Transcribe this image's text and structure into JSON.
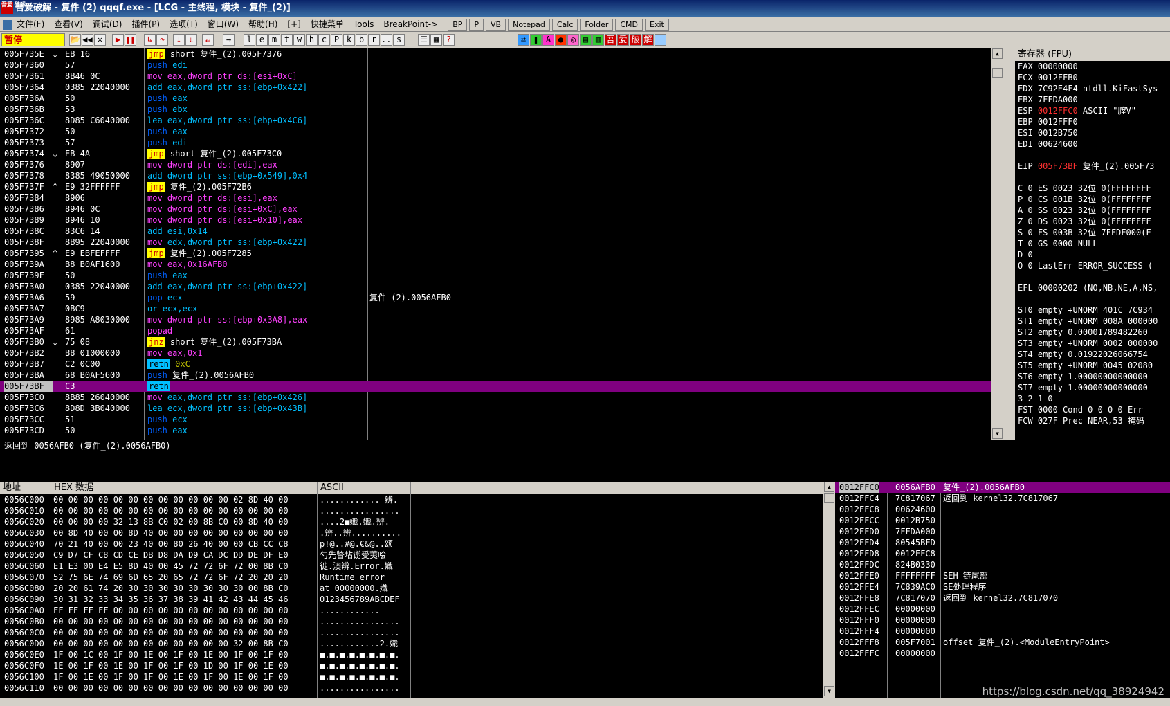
{
  "window": {
    "title": "吾爱破解 - 复件 (2) qqqf.exe - [LCG - 主线程, 模块 - 复件_(2)]",
    "logo": "吾爱 破解"
  },
  "menu": {
    "items": [
      "文件(F)",
      "查看(V)",
      "调试(D)",
      "插件(P)",
      "选项(T)",
      "窗口(W)",
      "帮助(H)",
      "[+]",
      "快捷菜单",
      "Tools",
      "BreakPoint->"
    ],
    "buttons": [
      "BP",
      "P",
      "VB",
      "Notepad",
      "Calc",
      "Folder",
      "CMD",
      "Exit"
    ]
  },
  "toolbar": {
    "status": "暂停",
    "letters": [
      "l",
      "e",
      "m",
      "t",
      "w",
      "h",
      "c",
      "P",
      "k",
      "b",
      "r",
      "...",
      "s"
    ]
  },
  "cpu": {
    "rows": [
      {
        "addr": "005F735E",
        "mark": "⌄",
        "hex": "EB 16",
        "op": "jmp",
        "cls": "jmp",
        "arg": "short 复件_(2).005F7376",
        "argcls": "white",
        "cmt": ""
      },
      {
        "addr": "005F7360",
        "mark": "",
        "hex": "57",
        "op": "push",
        "cls": "push",
        "arg": "edi",
        "argcls": "ops",
        "cmt": ""
      },
      {
        "addr": "005F7361",
        "mark": "",
        "hex": "8B46 0C",
        "op": "mov",
        "cls": "mov",
        "arg": "eax,dword ptr ds:[esi+0xC]",
        "argcls": "opm",
        "cmt": ""
      },
      {
        "addr": "005F7364",
        "mark": "",
        "hex": "0385 22040000",
        "op": "add",
        "cls": "add",
        "arg": "eax,dword ptr ss:[ebp+0x422]",
        "argcls": "ops",
        "cmt": ""
      },
      {
        "addr": "005F736A",
        "mark": "",
        "hex": "50",
        "op": "push",
        "cls": "push",
        "arg": "eax",
        "argcls": "ops",
        "cmt": ""
      },
      {
        "addr": "005F736B",
        "mark": "",
        "hex": "53",
        "op": "push",
        "cls": "push",
        "arg": "ebx",
        "argcls": "ops",
        "cmt": ""
      },
      {
        "addr": "005F736C",
        "mark": "",
        "hex": "8D85 C6040000",
        "op": "lea",
        "cls": "add",
        "arg": "eax,dword ptr ss:[ebp+0x4C6]",
        "argcls": "ops",
        "cmt": ""
      },
      {
        "addr": "005F7372",
        "mark": "",
        "hex": "50",
        "op": "push",
        "cls": "push",
        "arg": "eax",
        "argcls": "ops",
        "cmt": ""
      },
      {
        "addr": "005F7373",
        "mark": "",
        "hex": "57",
        "op": "push",
        "cls": "push",
        "arg": "edi",
        "argcls": "ops",
        "cmt": ""
      },
      {
        "addr": "005F7374",
        "mark": "⌄",
        "hex": "EB 4A",
        "op": "jmp",
        "cls": "jmp",
        "arg": "short 复件_(2).005F73C0",
        "argcls": "white",
        "cmt": ""
      },
      {
        "addr": "005F7376",
        "mark": "",
        "hex": "8907",
        "op": "mov",
        "cls": "mov",
        "arg": "dword ptr ds:[edi],eax",
        "argcls": "opm",
        "cmt": ""
      },
      {
        "addr": "005F7378",
        "mark": "",
        "hex": "8385 49050000",
        "op": "add",
        "cls": "add",
        "arg": "dword ptr ss:[ebp+0x549],0x4",
        "argcls": "ops",
        "cmt": ""
      },
      {
        "addr": "005F737F",
        "mark": "^",
        "hex": "E9 32FFFFFF",
        "op": "jmp",
        "cls": "jmp",
        "arg": "复件_(2).005F72B6",
        "argcls": "white",
        "cmt": ""
      },
      {
        "addr": "005F7384",
        "mark": "",
        "hex": "8906",
        "op": "mov",
        "cls": "mov",
        "arg": "dword ptr ds:[esi],eax",
        "argcls": "opm",
        "cmt": ""
      },
      {
        "addr": "005F7386",
        "mark": "",
        "hex": "8946 0C",
        "op": "mov",
        "cls": "mov",
        "arg": "dword ptr ds:[esi+0xC],eax",
        "argcls": "opm",
        "cmt": ""
      },
      {
        "addr": "005F7389",
        "mark": "",
        "hex": "8946 10",
        "op": "mov",
        "cls": "mov",
        "arg": "dword ptr ds:[esi+0x10],eax",
        "argcls": "opm",
        "cmt": ""
      },
      {
        "addr": "005F738C",
        "mark": "",
        "hex": "83C6 14",
        "op": "add",
        "cls": "add",
        "arg": "esi,0x14",
        "argcls": "ops",
        "cmt": ""
      },
      {
        "addr": "005F738F",
        "mark": "",
        "hex": "8B95 22040000",
        "op": "mov",
        "cls": "mov",
        "arg": "edx,dword ptr ss:[ebp+0x422]",
        "argcls": "ops",
        "cmt": ""
      },
      {
        "addr": "005F7395",
        "mark": "^",
        "hex": "E9 EBFEFFFF",
        "op": "jmp",
        "cls": "jmp",
        "arg": "复件_(2).005F7285",
        "argcls": "white",
        "cmt": ""
      },
      {
        "addr": "005F739A",
        "mark": "",
        "hex": "B8 B0AF1600",
        "op": "mov",
        "cls": "mov",
        "arg": "eax,0x16AFB0",
        "argcls": "opm",
        "cmt": ""
      },
      {
        "addr": "005F739F",
        "mark": "",
        "hex": "50",
        "op": "push",
        "cls": "push",
        "arg": "eax",
        "argcls": "ops",
        "cmt": ""
      },
      {
        "addr": "005F73A0",
        "mark": "",
        "hex": "0385 22040000",
        "op": "add",
        "cls": "add",
        "arg": "eax,dword ptr ss:[ebp+0x422]",
        "argcls": "ops",
        "cmt": ""
      },
      {
        "addr": "005F73A6",
        "mark": "",
        "hex": "59",
        "op": "pop",
        "cls": "push",
        "arg": "ecx",
        "argcls": "ops",
        "cmt": "复件_(2).0056AFB0"
      },
      {
        "addr": "005F73A7",
        "mark": "",
        "hex": "0BC9",
        "op": "or",
        "cls": "add",
        "arg": "ecx,ecx",
        "argcls": "ops",
        "cmt": ""
      },
      {
        "addr": "005F73A9",
        "mark": "",
        "hex": "8985 A8030000",
        "op": "mov",
        "cls": "mov",
        "arg": "dword ptr ss:[ebp+0x3A8],eax",
        "argcls": "opm",
        "cmt": ""
      },
      {
        "addr": "005F73AF",
        "mark": "",
        "hex": "61",
        "op": "popad",
        "cls": "mov",
        "arg": "",
        "argcls": "ops",
        "cmt": ""
      },
      {
        "addr": "005F73B0",
        "mark": "⌄",
        "hex": "75 08",
        "op": "jnz",
        "cls": "jmp",
        "arg": "short 复件_(2).005F73BA",
        "argcls": "white",
        "cmt": ""
      },
      {
        "addr": "005F73B2",
        "mark": "",
        "hex": "B8 01000000",
        "op": "mov",
        "cls": "mov",
        "arg": "eax,0x1",
        "argcls": "opm",
        "cmt": ""
      },
      {
        "addr": "005F73B7",
        "mark": "",
        "hex": "C2 0C00",
        "op": "retn",
        "cls": "retn",
        "arg": "0xC",
        "argcls": "num",
        "cmt": ""
      },
      {
        "addr": "005F73BA",
        "mark": "",
        "hex": "68 B0AF5600",
        "op": "push",
        "cls": "push",
        "arg": "复件_(2).0056AFB0",
        "argcls": "white",
        "cmt": ""
      },
      {
        "addr": "005F73BF",
        "mark": "",
        "hex": "C3",
        "op": "retn",
        "cls": "retn",
        "arg": "",
        "argcls": "ops",
        "cmt": "",
        "selected": true
      },
      {
        "addr": "005F73C0",
        "mark": "",
        "hex": "8B85 26040000",
        "op": "mov",
        "cls": "mov",
        "arg": "eax,dword ptr ss:[ebp+0x426]",
        "argcls": "ops",
        "cmt": ""
      },
      {
        "addr": "005F73C6",
        "mark": "",
        "hex": "8D8D 3B040000",
        "op": "lea",
        "cls": "add",
        "arg": "ecx,dword ptr ss:[ebp+0x43B]",
        "argcls": "ops",
        "cmt": ""
      },
      {
        "addr": "005F73CC",
        "mark": "",
        "hex": "51",
        "op": "push",
        "cls": "push",
        "arg": "ecx",
        "argcls": "ops",
        "cmt": ""
      },
      {
        "addr": "005F73CD",
        "mark": "",
        "hex": "50",
        "op": "push",
        "cls": "push",
        "arg": "eax",
        "argcls": "ops",
        "cmt": ""
      }
    ]
  },
  "info": {
    "line": "返回到 0056AFB0 (复件_(2).0056AFB0)"
  },
  "registers": {
    "header": "寄存器 (FPU)",
    "lines": [
      {
        "t": "EAX 00000000",
        "red": false
      },
      {
        "t": "ECX 0012FFB0",
        "red": false
      },
      {
        "t": "EDX 7C92E4F4 ntdll.KiFastSys",
        "red": false
      },
      {
        "t": "EBX 7FFDA000",
        "red": false
      },
      {
        "t": "ESP 0012FFC0 ASCII \"膣V\"",
        "red": true
      },
      {
        "t": "EBP 0012FFF0",
        "red": false
      },
      {
        "t": "ESI 0012B750",
        "red": false
      },
      {
        "t": "EDI 00624600",
        "red": false
      },
      {
        "t": "",
        "red": false
      },
      {
        "t": "EIP 005F73BF 复件_(2).005F73",
        "red": true
      },
      {
        "t": "",
        "red": false
      },
      {
        "t": "C 0  ES 0023 32位 0(FFFFFFFF",
        "red": false
      },
      {
        "t": "P 0  CS 001B 32位 0(FFFFFFFF",
        "red": false
      },
      {
        "t": "A 0  SS 0023 32位 0(FFFFFFFF",
        "red": false
      },
      {
        "t": "Z 0  DS 0023 32位 0(FFFFFFFF",
        "red": false
      },
      {
        "t": "S 0  FS 003B 32位 7FFDF000(F",
        "red": false
      },
      {
        "t": "T 0  GS 0000 NULL",
        "red": false
      },
      {
        "t": "D 0",
        "red": false
      },
      {
        "t": "O 0  LastErr ERROR_SUCCESS (",
        "red": false
      },
      {
        "t": "",
        "red": false
      },
      {
        "t": "EFL 00000202 (NO,NB,NE,A,NS,",
        "red": false
      },
      {
        "t": "",
        "red": false
      },
      {
        "t": "ST0 empty +UNORM 401C 7C934",
        "red": false
      },
      {
        "t": "ST1 empty +UNORM 008A 000000",
        "red": false
      },
      {
        "t": "ST2 empty 0.00001789482260",
        "red": false
      },
      {
        "t": "ST3 empty +UNORM 0002 000000",
        "red": false
      },
      {
        "t": "ST4 empty 0.01922026066754",
        "red": false
      },
      {
        "t": "ST5 empty +UNORM 0045 02080",
        "red": false
      },
      {
        "t": "ST6 empty 1.00000000000000",
        "red": false
      },
      {
        "t": "ST7 empty 1.00000000000000",
        "red": false
      },
      {
        "t": "               3 2 1 0",
        "red": false
      },
      {
        "t": "FST 0000  Cond 0 0 0 0  Err",
        "red": false
      },
      {
        "t": "FCW 027F  Prec NEAR,53  掩码",
        "red": false
      }
    ]
  },
  "dump": {
    "headers": [
      "地址",
      "HEX 数据",
      "ASCII"
    ],
    "rows": [
      {
        "a": "0056C000",
        "h": "00 00 00 00 00 00 00 00 00 00 00 00 02 8D 40 00",
        "s": "............-辨."
      },
      {
        "a": "0056C010",
        "h": "00 00 00 00 00 00 00 00 00 00 00 00 00 00 00 00",
        "s": "................"
      },
      {
        "a": "0056C020",
        "h": "00 00 00 00 32 13 8B C0 02 00 8B C0 00 8D 40 00",
        "s": "....2■嬂.嬂.辨."
      },
      {
        "a": "0056C030",
        "h": "00 8D 40 00 00 8D 40 00 00 00 00 00 00 00 00 00",
        "s": ".辨..辨.........."
      },
      {
        "a": "0056C040",
        "h": "70 21 40 00 00 23 40 00 80 26 40 00 00 CB CC C8",
        "s": "p!@..#@.€&@..颂"
      },
      {
        "a": "0056C050",
        "h": "C9 D7 CF C8 CD CE DB D8 DA D9 CA DC DD DE DF E0",
        "s": "勺先瞥坫谫受荑哙"
      },
      {
        "a": "0056C060",
        "h": "E1 E3 00 E4 E5 8D 40 00 45 72 72 6F 72 00 8B C0",
        "s": "徙.澳辨.Error.嬂"
      },
      {
        "a": "0056C070",
        "h": "52 75 6E 74 69 6D 65 20 65 72 72 6F 72 20 20 20",
        "s": "Runtime error   "
      },
      {
        "a": "0056C080",
        "h": "20 20 61 74 20 30 30 30 30 30 30 30 30 00 8B C0",
        "s": "  at 00000000.嬂"
      },
      {
        "a": "0056C090",
        "h": "30 31 32 33 34 35 36 37 38 39 41 42 43 44 45 46",
        "s": "0123456789ABCDEF"
      },
      {
        "a": "0056C0A0",
        "h": "FF FF FF FF 00 00 00 00 00 00 00 00 00 00 00 00",
        "s": "        ............"
      },
      {
        "a": "0056C0B0",
        "h": "00 00 00 00 00 00 00 00 00 00 00 00 00 00 00 00",
        "s": "................"
      },
      {
        "a": "0056C0C0",
        "h": "00 00 00 00 00 00 00 00 00 00 00 00 00 00 00 00",
        "s": "................"
      },
      {
        "a": "0056C0D0",
        "h": "00 00 00 00 00 00 00 00 00 00 00 00 32 00 8B C0",
        "s": "............2.嬂"
      },
      {
        "a": "0056C0E0",
        "h": "1F 00 1C 00 1F 00 1E 00 1F 00 1E 00 1F 00 1F 00",
        "s": "■.■.■.■.■.■.■.■."
      },
      {
        "a": "0056C0F0",
        "h": "1E 00 1F 00 1E 00 1F 00 1F 00 1D 00 1F 00 1E 00",
        "s": "■.■.■.■.■.■.■.■."
      },
      {
        "a": "0056C100",
        "h": "1F 00 1E 00 1F 00 1F 00 1E 00 1F 00 1E 00 1F 00",
        "s": "■.■.■.■.■.■.■.■."
      },
      {
        "a": "0056C110",
        "h": "00 00 00 00 00 00 00 00 00 00 00 00 00 00 00 00",
        "s": "................"
      }
    ]
  },
  "stack": {
    "rows": [
      {
        "a": "0012FFC0",
        "v": "0056AFB0",
        "c": "复件_(2).0056AFB0",
        "selected": true
      },
      {
        "a": "0012FFC4",
        "v": "7C817067",
        "c": "返回到 kernel32.7C817067"
      },
      {
        "a": "0012FFC8",
        "v": "00624600",
        "c": ""
      },
      {
        "a": "0012FFCC",
        "v": "0012B750",
        "c": ""
      },
      {
        "a": "0012FFD0",
        "v": "7FFDA000",
        "c": ""
      },
      {
        "a": "0012FFD4",
        "v": "80545BFD",
        "c": ""
      },
      {
        "a": "0012FFD8",
        "v": "0012FFC8",
        "c": ""
      },
      {
        "a": "0012FFDC",
        "v": "824B0330",
        "c": ""
      },
      {
        "a": "0012FFE0",
        "v": "FFFFFFFF",
        "c": "SEH 链尾部"
      },
      {
        "a": "0012FFE4",
        "v": "7C839AC0",
        "c": "SE处理程序"
      },
      {
        "a": "0012FFE8",
        "v": "7C817070",
        "c": "返回到 kernel32.7C817070"
      },
      {
        "a": "0012FFEC",
        "v": "00000000",
        "c": ""
      },
      {
        "a": "0012FFF0",
        "v": "00000000",
        "c": ""
      },
      {
        "a": "0012FFF4",
        "v": "00000000",
        "c": ""
      },
      {
        "a": "0012FFF8",
        "v": "005F7001",
        "c": "offset 复件_(2).<ModuleEntryPoint>"
      },
      {
        "a": "0012FFFC",
        "v": "00000000",
        "c": ""
      }
    ]
  },
  "watermark": "https://blog.csdn.net/qq_38924942"
}
